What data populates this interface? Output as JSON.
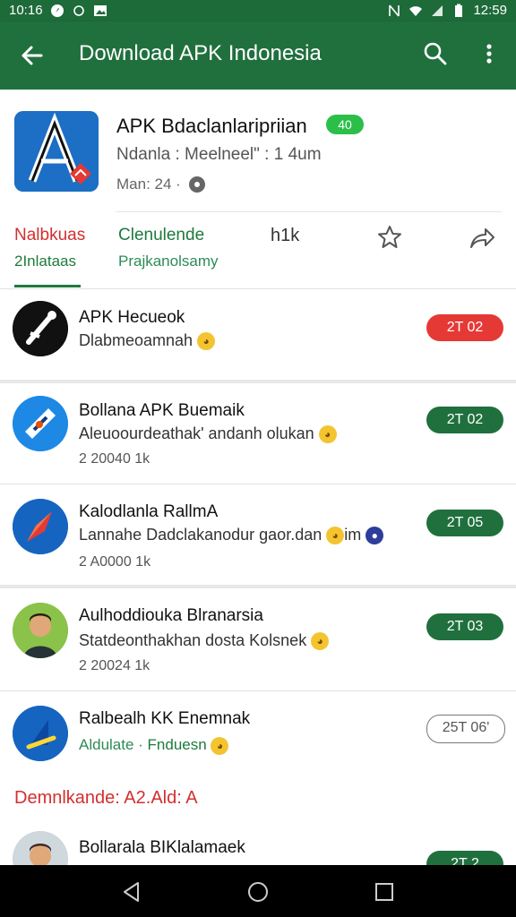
{
  "status_bar": {
    "time_left": "10:16",
    "time_right": "12:59"
  },
  "app_bar": {
    "title": "Download APK Indonesia"
  },
  "featured": {
    "name": "APK Bdaclanlaripriian",
    "badge": "40",
    "subtitle": "Ndanla : Meelneel\" : 1 4um",
    "meta": "Man: 24 ·",
    "tabs": [
      {
        "line1": "Nalbkuas",
        "line2": "2Inlataas"
      },
      {
        "line1": "Clenulende",
        "line2": "Prajkanolsamy"
      },
      {
        "line1": "h1k",
        "line2": ""
      }
    ]
  },
  "apps": [
    {
      "name": "APK Hecueok",
      "desc": "Dlabmeoamnah",
      "meta": "",
      "button": "2T 02",
      "button_style": "red"
    },
    {
      "name": "Bollana APK Buemaik",
      "desc": "Aleuoourdeathak' andanh olukan",
      "meta": "2 20040 1k",
      "button": "2T 02",
      "button_style": "green"
    },
    {
      "name": "Kalodlanla RallmA",
      "desc": "Lannahe Dadclakanodur gaor.dan",
      "desc_suffix": "im",
      "meta": "2 A0000 1k",
      "button": "2T 05",
      "button_style": "green"
    },
    {
      "name": "Aulhoddiouka Blranarsia",
      "desc": "Statdeonthakhan dosta Kolsnek",
      "meta": "2 20024 1k",
      "button": "2T 03",
      "button_style": "green"
    },
    {
      "name": "Ralbealh KK Enemnak",
      "desc": "Aldulate · ",
      "desc_highlight": "Fnduesn",
      "meta": "",
      "button": "25T 06'",
      "button_style": "outline"
    }
  ],
  "section_label": "Demnlkande: A2.Ald: A",
  "partial_app": {
    "name": "Bollarala BIKlalamaek",
    "button": "2T 2"
  },
  "colors": {
    "primary": "#20703e",
    "accent_red": "#e53935",
    "badge_green": "#2bbf4a"
  }
}
